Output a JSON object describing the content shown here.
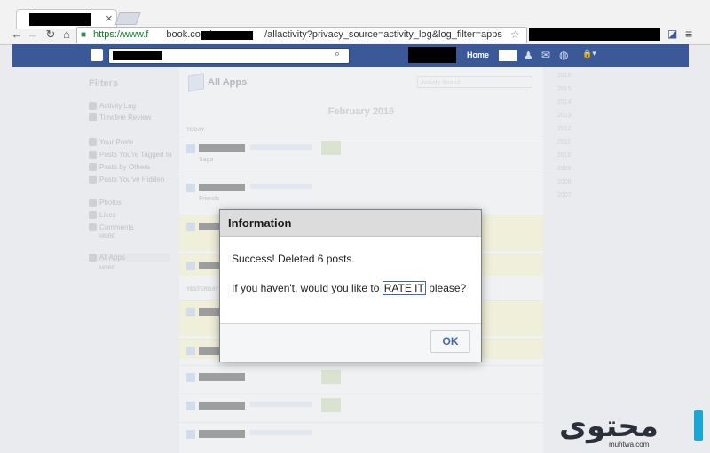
{
  "browser": {
    "url_prefix": "https://www.f",
    "url_mid": "book.com/",
    "url_suffix": "/allactivity?privacy_source=activity_log&log_filter=apps",
    "tab_close": "×"
  },
  "facebook": {
    "home_label": "Home",
    "filters_title": "Filters",
    "filters": [
      "Activity Log",
      "Timeline Review",
      "Your Posts",
      "Posts You're Tagged In",
      "Posts by Others",
      "Posts You've Hidden",
      "Photos",
      "Likes",
      "Comments",
      "MORE",
      "All Apps",
      "MORE"
    ],
    "page_title": "All Apps",
    "search_placeholder": "Activity Search",
    "month": "February 2016",
    "sections": [
      "TODAY",
      "YESTERDAY"
    ],
    "row_sublabels": [
      "Saga",
      "Friends"
    ],
    "years": [
      "2016",
      "2015",
      "2014",
      "2013",
      "2012",
      "2011",
      "2010",
      "2009",
      "2008",
      "2007"
    ]
  },
  "dialog": {
    "title": "Information",
    "message": "Success! Deleted 6 posts.",
    "prompt_before": "If you haven't, would you like to ",
    "link_text": "RATE IT",
    "prompt_after": " please?",
    "ok_label": "OK"
  },
  "watermark": {
    "text": "محتوى",
    "sub": "muhtwa.com"
  }
}
